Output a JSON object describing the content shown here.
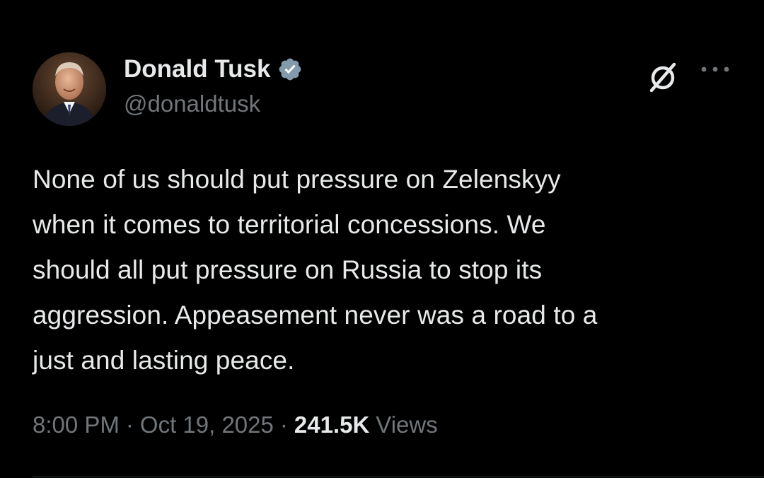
{
  "author": {
    "display_name": "Donald Tusk",
    "handle": "@donaldtusk",
    "verified": true,
    "verified_color": "#829aab",
    "avatar_icon": "profile-photo"
  },
  "actions": {
    "grok_icon": "grok-icon",
    "more_icon": "more-options-icon"
  },
  "tweet": {
    "text": "None of us should put pressure on Zelenskyy\nwhen it comes to territorial concessions. We\nshould all put pressure on Russia to stop its\naggression. Appeasement never was a road to a\njust and lasting peace."
  },
  "meta": {
    "time": "8:00 PM",
    "separator": "·",
    "date": "Oct 19, 2025",
    "views_count": "241.5K",
    "views_label": "Views"
  },
  "colors": {
    "background": "#000000",
    "primary_text": "#e7e9ea",
    "secondary_text": "#71767b"
  }
}
